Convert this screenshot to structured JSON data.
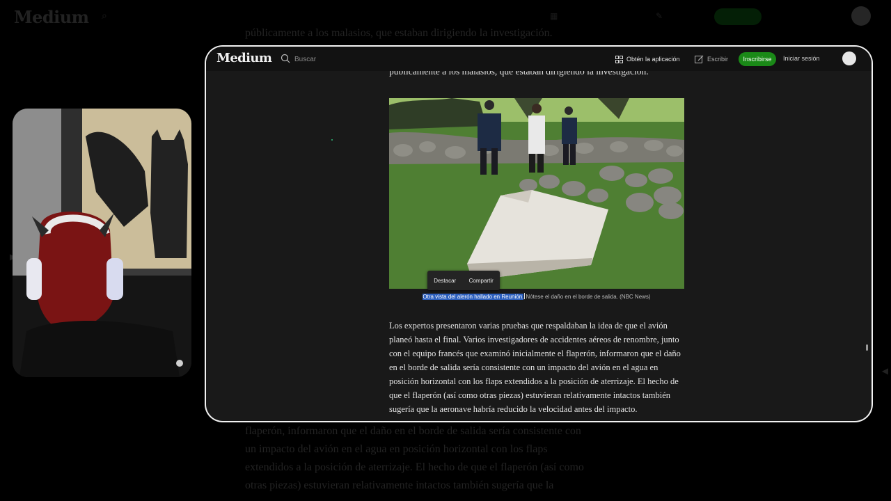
{
  "background": {
    "logo": "Medium",
    "text_lines": [
      "públicamente a los malasios, que estaban dirigiendo la investigación.",
      "flaperón, informaron que el daño en el borde de salida sería consistente con",
      "un impacto del avión en el agua en posición horizontal con los flaps",
      "extendidos a la posición de aterrizaje. El hecho de que el flaperón (así como",
      "otras piezas) estuvieran relativamente intactos también sugería que la"
    ]
  },
  "header": {
    "logo": "Medium",
    "search_placeholder": "Buscar",
    "get_app_label": "Obtén la aplicación",
    "write_label": "Escribir",
    "signup_label": "Inscribirse",
    "signin_label": "Iniciar sesión"
  },
  "article": {
    "prev_line": "públicamente a los malasios, que estaban dirigiendo la investigación.",
    "caption_selected": "Otra vista del alerón hallado en Reunión.",
    "caption_rest": "Nótese el daño en el borde de salida. (NBC News)",
    "highlight_toolbar": {
      "highlight_label": "Destacar",
      "share_label": "Compartir"
    },
    "paragraph": "Los expertos presentaron varias pruebas que respaldaban la idea de que el avión planeó hasta el final. Varios investigadores de accidentes aéreos de renombre, junto con el equipo francés que examinó inicialmente el flaperón, informaron que el daño en el borde de salida sería consistente con un impacto del avión en el agua en posición horizontal con los flaps extendidos a la posición de aterrizaje. El hecho de que el flaperón (así como otras piezas) estuvieran relativamente intactos también sugería que la aeronave habría reducido la velocidad antes del impacto."
  },
  "colors": {
    "accent_green": "#1a8917",
    "selection_blue": "#2c5fbd"
  }
}
